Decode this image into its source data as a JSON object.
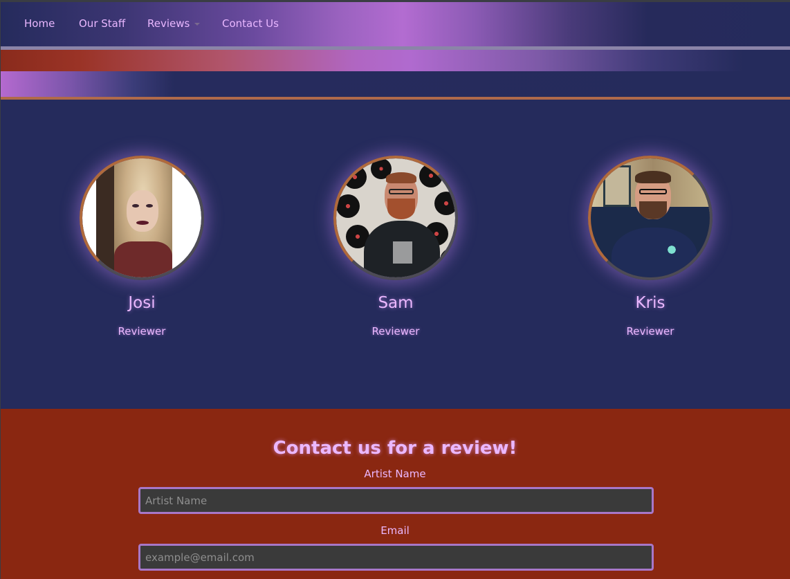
{
  "nav": {
    "items": [
      {
        "label": "Home"
      },
      {
        "label": "Our Staff"
      },
      {
        "label": "Reviews"
      },
      {
        "label": "Contact Us"
      }
    ]
  },
  "staff": [
    {
      "name": "Josi",
      "role": "Reviewer"
    },
    {
      "name": "Sam",
      "role": "Reviewer"
    },
    {
      "name": "Kris",
      "role": "Reviewer"
    }
  ],
  "contact": {
    "title": "Contact us for a review!",
    "artist_label": "Artist Name",
    "artist_placeholder": "Artist Name",
    "email_label": "Email",
    "email_placeholder": "example@email.com"
  },
  "colors": {
    "page_bg": "#252b5c",
    "accent_text": "#ebb8ff",
    "contact_bg": "#8a2711",
    "input_border": "#a877c8"
  }
}
